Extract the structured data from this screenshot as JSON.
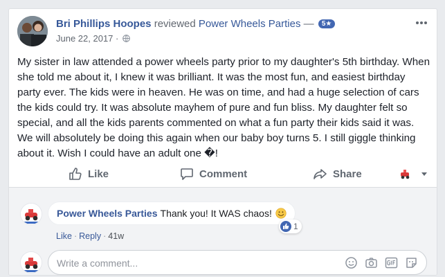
{
  "post": {
    "author": "Bri Phillips Hoopes",
    "verb": "reviewed",
    "page_name": "Power Wheels Parties",
    "dash": "—",
    "rating": "5★",
    "date": "June 22, 2017",
    "date_separator": "·",
    "body": "My sister in law attended a power wheels party prior to my daughter's 5th birthday. When she told me about it, I knew it was brilliant. It was the most fun, and easiest birthday party ever. The kids were in heaven. He was on time, and had a huge selection of cars the kids could try. It was absolute mayhem of pure and fun bliss. My daughter felt so special, and all the kids parents commented on what a fun party their kids said it was. We will absolutely be doing this again when our baby boy turns 5. I still giggle thinking about it. Wish I could have an adult one �!"
  },
  "actions": {
    "like": "Like",
    "comment": "Comment",
    "share": "Share"
  },
  "comment": {
    "author": "Power Wheels Parties",
    "text": "Thank you! It WAS chaos!",
    "reaction_count": "1",
    "like": "Like",
    "reply": "Reply",
    "separator": "·",
    "age": "41w"
  },
  "composer": {
    "placeholder": "Write a comment..."
  },
  "icons": [
    "globe-icon",
    "more-options-icon",
    "like-icon",
    "comment-icon",
    "share-icon",
    "emoji-icon",
    "camera-icon",
    "gif-icon",
    "sticker-icon",
    "thumbs-up-reaction-icon",
    "smile-emoji-icon"
  ],
  "colors": {
    "link": "#365899",
    "badge": "#4267b2",
    "action_gray": "#606770"
  }
}
